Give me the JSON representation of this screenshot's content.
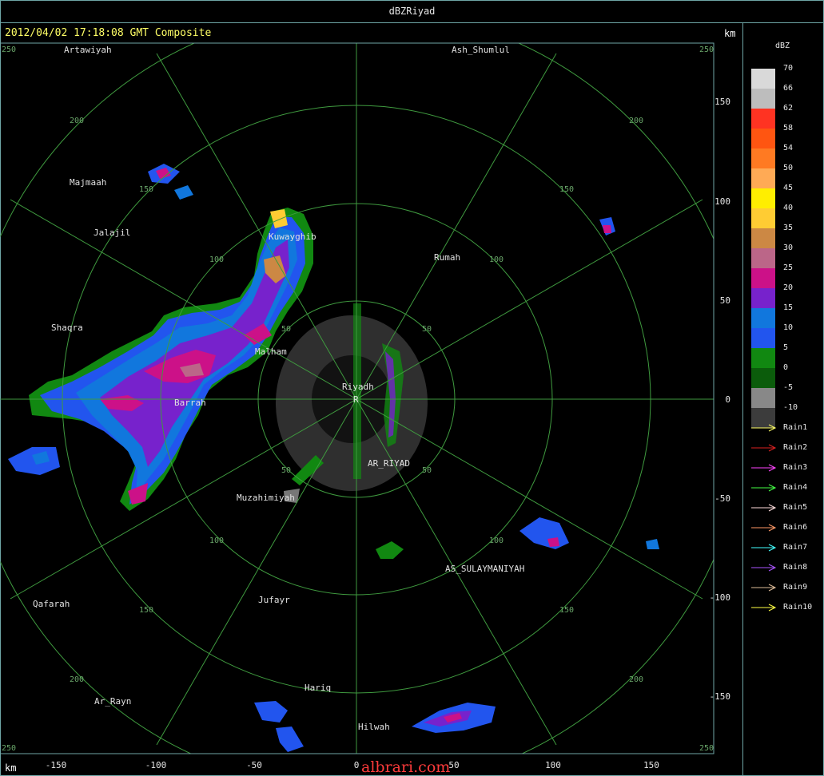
{
  "window": {
    "title": "dBZRiyad"
  },
  "header": {
    "timestamp": "2012/04/02 17:18:08 GMT Composite"
  },
  "axes": {
    "unit_top": "km",
    "unit_bottom": "km",
    "x_ticks": [
      "-150",
      "-100",
      "-50",
      "0",
      "50",
      "100",
      "150"
    ],
    "y_ticks": [
      "150",
      "100",
      "50",
      "0",
      "-50",
      "-100",
      "-150"
    ],
    "corner_labels": [
      "250",
      "250",
      "250",
      "250"
    ]
  },
  "range_rings_km": [
    "50",
    "100",
    "150",
    "200"
  ],
  "center": {
    "name": "Riyadh",
    "marker": "R"
  },
  "cities": [
    "Artawiyah",
    "Ash_Shumlul",
    "Majmaah",
    "Jalajil",
    "Kuwayghib",
    "Rumah",
    "Shaqra",
    "Malham",
    "Barrah",
    "AR_RIYAD",
    "Muzahimiyah",
    "AS_SULAYMANIYAH",
    "Qafarah",
    "Jufayr",
    "Hariq",
    "Ar_Rayn",
    "Hilwah"
  ],
  "legend": {
    "title": "dBZ",
    "scale": [
      {
        "label": "70",
        "color": "#d9d9d9"
      },
      {
        "label": "66",
        "color": "#bdbdbd"
      },
      {
        "label": "62",
        "color": "#ff3322"
      },
      {
        "label": "58",
        "color": "#ff5511"
      },
      {
        "label": "54",
        "color": "#ff7a22"
      },
      {
        "label": "50",
        "color": "#ffaa55"
      },
      {
        "label": "45",
        "color": "#ffee00"
      },
      {
        "label": "40",
        "color": "#ffcc33"
      },
      {
        "label": "35",
        "color": "#cc8844"
      },
      {
        "label": "30",
        "color": "#bb6688"
      },
      {
        "label": "25",
        "color": "#cc1188"
      },
      {
        "label": "20",
        "color": "#7722cc"
      },
      {
        "label": "15",
        "color": "#1177dd"
      },
      {
        "label": "10",
        "color": "#2255ee"
      },
      {
        "label": "5",
        "color": "#118811"
      },
      {
        "label": "0",
        "color": "#0b5c0b"
      },
      {
        "label": "-5",
        "color": "#888888"
      },
      {
        "label": "-10",
        "color": "#3c3c3c"
      }
    ],
    "rain_tracks": [
      {
        "label": "Rain1",
        "color": "#ffff66"
      },
      {
        "label": "Rain2",
        "color": "#dd2222"
      },
      {
        "label": "Rain3",
        "color": "#ff44ff"
      },
      {
        "label": "Rain4",
        "color": "#44ff44"
      },
      {
        "label": "Rain5",
        "color": "#ffdddd"
      },
      {
        "label": "Rain6",
        "color": "#ff9966"
      },
      {
        "label": "Rain7",
        "color": "#44ffff"
      },
      {
        "label": "Rain8",
        "color": "#aa55ff"
      },
      {
        "label": "Rain9",
        "color": "#ddbb99"
      },
      {
        "label": "Rain10",
        "color": "#ffff44"
      }
    ]
  },
  "watermark": "albrari.com"
}
